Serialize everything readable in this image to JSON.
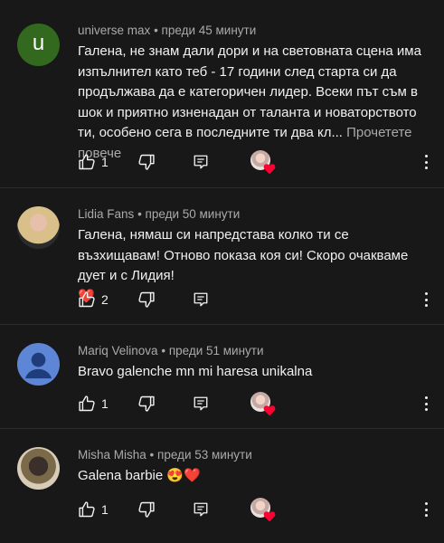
{
  "comments": [
    {
      "author": "universe max",
      "time": "преди 45 минути",
      "avatar_letter": "u",
      "avatar_color": "#33691e",
      "text": "Галена, не знам дали дори и на световната сцена има изпълнител като теб - 17 години след старта си да продължава да е категоричен лидер. Всеки път съм в шок и приятно изненадан от таланта и новаторството ти, особено сега в последните ти два кл...",
      "more": "Прочетете повече",
      "likes": "1",
      "hearted": true
    },
    {
      "author": "Lidia Fans",
      "time": "преди 50 минути",
      "text": "Галена, нямаш си напредстава колко ти се възхищавам! Отново показа коя си! Скоро очакваме дует и с Лидия!",
      "emoji": "❤️",
      "likes": "2",
      "hearted": false
    },
    {
      "author": "Mariq Velinova",
      "time": "преди 51 минути",
      "text": "Bravo galenche mn mi haresa unikalna",
      "likes": "1",
      "hearted": true
    },
    {
      "author": "Misha Misha",
      "time": "преди 53 минути",
      "text": "Galena barbie",
      "emoji": "😍❤️",
      "likes": "1",
      "hearted": true
    }
  ],
  "colors": {
    "background": "#181818",
    "text": "#f1f1f1",
    "secondary": "#aaaaaa",
    "heart": "#ff0033",
    "default_avatar": "#5d86d6"
  },
  "icons": [
    "like-icon",
    "dislike-icon",
    "reply-icon",
    "heart-badge-icon",
    "more-vert-icon"
  ]
}
